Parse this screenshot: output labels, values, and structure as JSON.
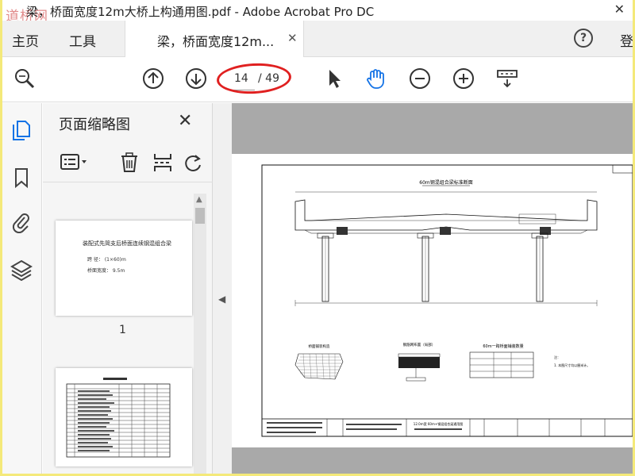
{
  "window": {
    "title": "梁，桥面宽度12m大桥上构通用图.pdf - Adobe Acrobat Pro DC",
    "watermark": "道桥网",
    "close_glyph": "✕"
  },
  "tabs": {
    "home": "主页",
    "tools": "工具",
    "document": "梁，桥面宽度12m...",
    "doc_close": "✕",
    "help": "?",
    "signin": "登"
  },
  "toolbar": {
    "current_page": "14",
    "total_pages": "/ 49",
    "icons": [
      "search-zoom-icon",
      "previous-page-icon",
      "next-page-icon",
      "select-cursor-icon",
      "hand-tool-icon",
      "zoom-out-icon",
      "zoom-in-icon",
      "page-fit-icon"
    ]
  },
  "rail": {
    "icons": [
      "page-thumbnails-icon",
      "bookmarks-icon",
      "attachments-icon",
      "layers-icon"
    ]
  },
  "thumbnail_panel": {
    "title": "页面缩略图",
    "close": "✕",
    "pages": [
      {
        "number": "1",
        "heading": "装配式先简支后桥面连续钢混组合梁",
        "line1": "跨    径：  (1×60)m",
        "line2": "桥面宽度：  9.5m"
      }
    ]
  },
  "drawing": {
    "section_title": "60m钢混组合梁标准断面",
    "detail1": "桥面铺装构造",
    "detail2": "钢筋网布置（局部）",
    "table_title": "60m一跨桥面铺装数量",
    "note": "注：",
    "note1": "1. 本图尺寸均以厘米计。",
    "title_block": "12.0m宽 60m+钢混组合梁通用图"
  },
  "colors": {
    "accent": "#1473e6",
    "highlight_circle": "#e02020",
    "doc_bg": "#a9a9a9",
    "border": "#f4e97a"
  }
}
